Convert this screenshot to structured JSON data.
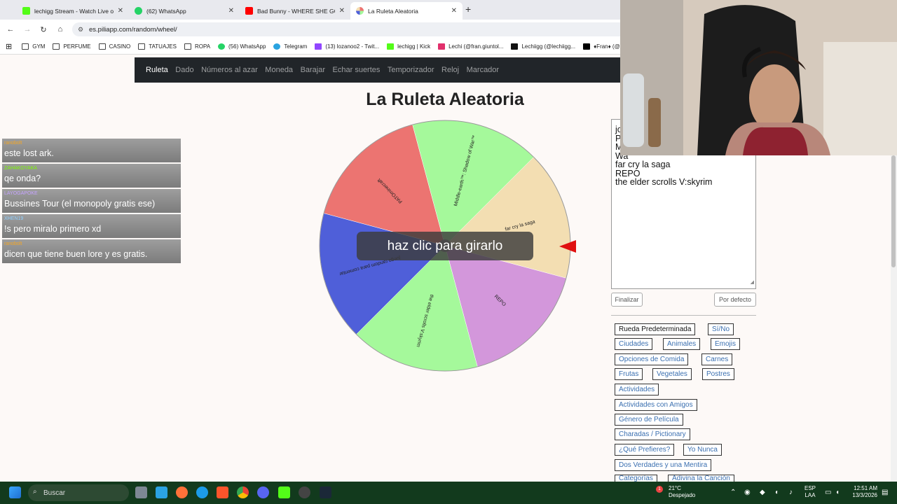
{
  "browser": {
    "tabs": [
      {
        "title": "lechigg Stream - Watch Live on",
        "icon_color": "#53fc18",
        "active": false
      },
      {
        "title": "(62) WhatsApp",
        "icon_color": "#25d366",
        "active": false
      },
      {
        "title": "Bad Bunny - WHERE SHE GOES",
        "icon_color": "#ff0000",
        "active": false
      },
      {
        "title": "La Ruleta Aleatoria",
        "icon_color": "#f5a623",
        "active": true
      }
    ],
    "url": "es.piliapp.com/random/wheel/",
    "bookmarks": [
      {
        "label": "GYM",
        "icon": "folder-icon"
      },
      {
        "label": "PERFUME",
        "icon": "folder-icon"
      },
      {
        "label": "CASINO",
        "icon": "folder-icon"
      },
      {
        "label": "TATUAJES",
        "icon": "folder-icon"
      },
      {
        "label": "ROPA",
        "icon": "folder-icon"
      },
      {
        "label": "(56) WhatsApp",
        "icon": "whatsapp-icon"
      },
      {
        "label": "Telegram",
        "icon": "telegram-icon"
      },
      {
        "label": "(13) lozanoo2 - Twit...",
        "icon": "twitch-icon"
      },
      {
        "label": "lechigg | Kick",
        "icon": "kick-icon"
      },
      {
        "label": "Lechi (@fran.giuntol...",
        "icon": "instagram-icon"
      },
      {
        "label": "Lechiigg (@lechiigg...",
        "icon": "tiktok-icon"
      },
      {
        "label": "♦Fran♦ (@",
        "icon": "x-icon"
      }
    ]
  },
  "site_nav": [
    "Ruleta",
    "Dado",
    "Números al azar",
    "Moneda",
    "Barajar",
    "Echar suertes",
    "Temporizador",
    "Reloj",
    "Marcador"
  ],
  "page": {
    "title": "La Ruleta Aleatoria",
    "spin_label": "haz clic para girarlo"
  },
  "wheel": {
    "slices": [
      {
        "label": "PATOminecraft",
        "color": "#ec7471"
      },
      {
        "label": "Middle-earth™: Shadow of War™",
        "color": "#a5f99b"
      },
      {
        "label": "far cry la saga",
        "color": "#f3deb2"
      },
      {
        "label": "REPO",
        "color": "#d397db"
      },
      {
        "label": "the elder scrolls V:skyrim",
        "color": "#a5f99b"
      },
      {
        "label": "juego random para comentar",
        "color": "#4f5fd9"
      }
    ],
    "pointer_color": "#e01010"
  },
  "chat": [
    {
      "user": "ranobolt",
      "user_color": "#f5a623",
      "text": "este lost ark."
    },
    {
      "user": "ZAHAKOYAKA",
      "user_color": "#7cfc00",
      "text": "qe onda?"
    },
    {
      "user": "LAYOGAPOKE",
      "user_color": "#c5a3ff",
      "text": "Bussines Tour (el monopoly gratis ese)"
    },
    {
      "user": "XHEN19",
      "user_color": "#8fd0ff",
      "text": "!s pero miralo primero xd"
    },
    {
      "user": "ranobolt",
      "user_color": "#f5a623",
      "text": "dicen que tiene buen lore y es gratis."
    }
  ],
  "options": {
    "lines": [
      "jo",
      "P",
      "M",
      "Wa",
      "far cry la saga",
      "REPO",
      "the elder scrolls V:skyrim"
    ],
    "finish_label": "Finalizar",
    "default_label": "Por defecto"
  },
  "presets": [
    "Rueda Predeterminada",
    "Sí/No",
    "Ciudades",
    "Animales",
    "Emojis",
    "Opciones de Comida",
    "Carnes",
    "Frutas",
    "Vegetales",
    "Postres",
    "Actividades",
    "Actividades con Amigos",
    "Género de Película",
    "Charadas / Pictionary",
    "¿Qué Prefieres?",
    "Yo Nunca",
    "Dos Verdades y una Mentira",
    "Categorías",
    "Adivina la Canción"
  ],
  "taskbar": {
    "search_placeholder": "Buscar",
    "weather_temp": "21°C",
    "weather_desc": "Despejado",
    "weather_badge": "1",
    "lang_line1": "ESP",
    "lang_line2": "LAA",
    "time": "12:51 AM",
    "date": "13/3/2026"
  }
}
